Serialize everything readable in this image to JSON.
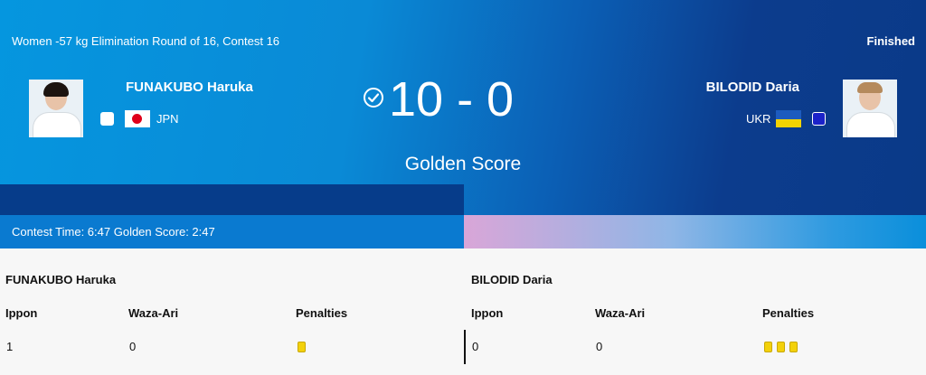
{
  "event": {
    "title": "Women -57 kg Elimination Round of 16, Contest 16",
    "status": "Finished"
  },
  "athletes": {
    "left": {
      "name": "FUNAKUBO Haruka",
      "country": "JPN",
      "color": "#ffffff",
      "flag": "japan-flag"
    },
    "right": {
      "name": "BILODID Daria",
      "country": "UKR",
      "color": "#1b22c9",
      "flag": "ukraine-flag"
    }
  },
  "scoreboard": {
    "score": "10 - 0",
    "golden_label": "Golden Score",
    "winner_icon": "check-circle-icon"
  },
  "time": {
    "text": "Contest Time: 6:47 Golden Score: 2:47"
  },
  "table": {
    "columns": [
      "Ippon",
      "Waza-Ari",
      "Penalties"
    ],
    "left": {
      "name": "FUNAKUBO Haruka",
      "ippon": "1",
      "waza_ari": "0",
      "penalties": 1
    },
    "right": {
      "name": "BILODID Daria",
      "ippon": "0",
      "waza_ari": "0",
      "penalties": 3
    }
  },
  "colors": {
    "penalty_card": "#f3d10a",
    "hero_start": "#0596df",
    "hero_end": "#0a3a88"
  }
}
